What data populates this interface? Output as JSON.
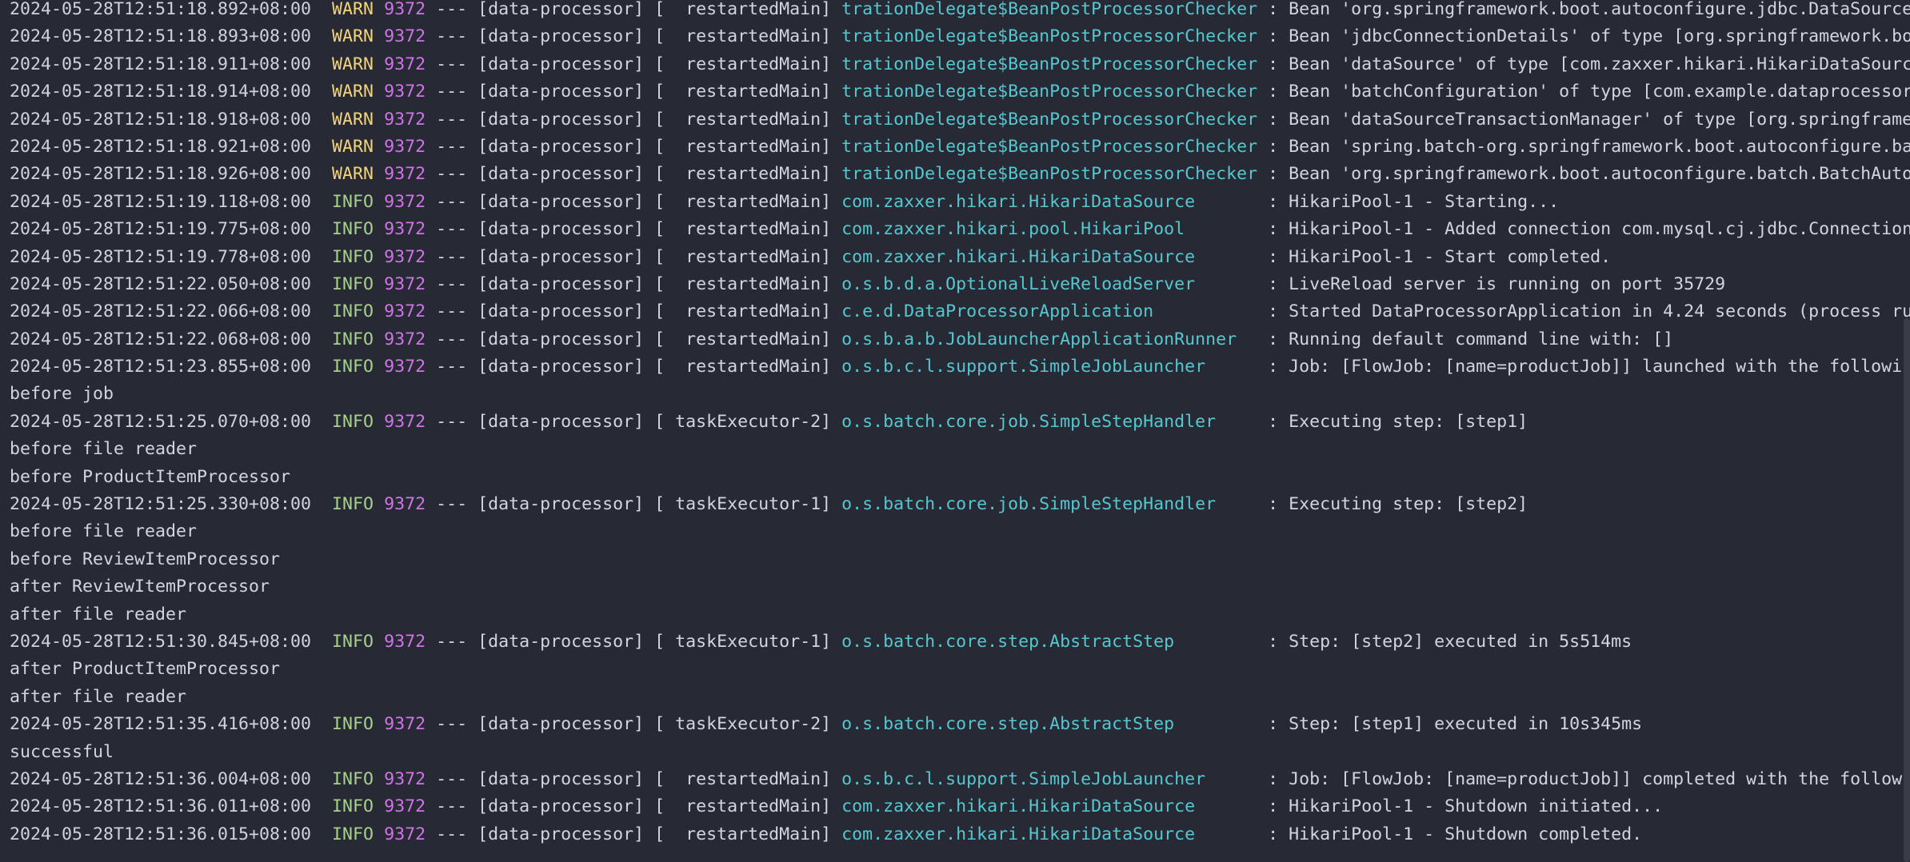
{
  "colors": {
    "background": "#272935",
    "timestamp": "#d0d2da",
    "warn": "#f2d37a",
    "info": "#a6d189",
    "pid": "#d174e8",
    "logger": "#55c7cf",
    "text": "#d3d5dd"
  },
  "lines": [
    {
      "type": "log",
      "ts": "2024-05-28T12:51:18.892+08:00",
      "level": "WARN",
      "pid": "9372",
      "app": " --- [data-processor] [  restartedMain] ",
      "logger": "trationDelegate$BeanPostProcessorChecker",
      "msg": " : Bean 'org.springframework.boot.autoconfigure.jdbc.DataSource"
    },
    {
      "type": "log",
      "ts": "2024-05-28T12:51:18.893+08:00",
      "level": "WARN",
      "pid": "9372",
      "app": " --- [data-processor] [  restartedMain] ",
      "logger": "trationDelegate$BeanPostProcessorChecker",
      "msg": " : Bean 'jdbcConnectionDetails' of type [org.springframework.bo"
    },
    {
      "type": "log",
      "ts": "2024-05-28T12:51:18.911+08:00",
      "level": "WARN",
      "pid": "9372",
      "app": " --- [data-processor] [  restartedMain] ",
      "logger": "trationDelegate$BeanPostProcessorChecker",
      "msg": " : Bean 'dataSource' of type [com.zaxxer.hikari.HikariDataSourc"
    },
    {
      "type": "log",
      "ts": "2024-05-28T12:51:18.914+08:00",
      "level": "WARN",
      "pid": "9372",
      "app": " --- [data-processor] [  restartedMain] ",
      "logger": "trationDelegate$BeanPostProcessorChecker",
      "msg": " : Bean 'batchConfiguration' of type [com.example.dataprocessor"
    },
    {
      "type": "log",
      "ts": "2024-05-28T12:51:18.918+08:00",
      "level": "WARN",
      "pid": "9372",
      "app": " --- [data-processor] [  restartedMain] ",
      "logger": "trationDelegate$BeanPostProcessorChecker",
      "msg": " : Bean 'dataSourceTransactionManager' of type [org.springframe"
    },
    {
      "type": "log",
      "ts": "2024-05-28T12:51:18.921+08:00",
      "level": "WARN",
      "pid": "9372",
      "app": " --- [data-processor] [  restartedMain] ",
      "logger": "trationDelegate$BeanPostProcessorChecker",
      "msg": " : Bean 'spring.batch-org.springframework.boot.autoconfigure.ba"
    },
    {
      "type": "log",
      "ts": "2024-05-28T12:51:18.926+08:00",
      "level": "WARN",
      "pid": "9372",
      "app": " --- [data-processor] [  restartedMain] ",
      "logger": "trationDelegate$BeanPostProcessorChecker",
      "msg": " : Bean 'org.springframework.boot.autoconfigure.batch.BatchAuto"
    },
    {
      "type": "log",
      "ts": "2024-05-28T12:51:19.118+08:00",
      "level": "INFO",
      "pid": "9372",
      "app": " --- [data-processor] [  restartedMain] ",
      "logger": "com.zaxxer.hikari.HikariDataSource      ",
      "msg": " : HikariPool-1 - Starting..."
    },
    {
      "type": "log",
      "ts": "2024-05-28T12:51:19.775+08:00",
      "level": "INFO",
      "pid": "9372",
      "app": " --- [data-processor] [  restartedMain] ",
      "logger": "com.zaxxer.hikari.pool.HikariPool       ",
      "msg": " : HikariPool-1 - Added connection com.mysql.cj.jdbc.Connection"
    },
    {
      "type": "log",
      "ts": "2024-05-28T12:51:19.778+08:00",
      "level": "INFO",
      "pid": "9372",
      "app": " --- [data-processor] [  restartedMain] ",
      "logger": "com.zaxxer.hikari.HikariDataSource      ",
      "msg": " : HikariPool-1 - Start completed."
    },
    {
      "type": "log",
      "ts": "2024-05-28T12:51:22.050+08:00",
      "level": "INFO",
      "pid": "9372",
      "app": " --- [data-processor] [  restartedMain] ",
      "logger": "o.s.b.d.a.OptionalLiveReloadServer      ",
      "msg": " : LiveReload server is running on port 35729"
    },
    {
      "type": "log",
      "ts": "2024-05-28T12:51:22.066+08:00",
      "level": "INFO",
      "pid": "9372",
      "app": " --- [data-processor] [  restartedMain] ",
      "logger": "c.e.d.DataProcessorApplication          ",
      "msg": " : Started DataProcessorApplication in 4.24 seconds (process ru"
    },
    {
      "type": "log",
      "ts": "2024-05-28T12:51:22.068+08:00",
      "level": "INFO",
      "pid": "9372",
      "app": " --- [data-processor] [  restartedMain] ",
      "logger": "o.s.b.a.b.JobLauncherApplicationRunner  ",
      "msg": " : Running default command line with: []"
    },
    {
      "type": "log",
      "ts": "2024-05-28T12:51:23.855+08:00",
      "level": "INFO",
      "pid": "9372",
      "app": " --- [data-processor] [  restartedMain] ",
      "logger": "o.s.b.c.l.support.SimpleJobLauncher     ",
      "msg": " : Job: [FlowJob: [name=productJob]] launched with the followin"
    },
    {
      "type": "plain",
      "text": "before job"
    },
    {
      "type": "log",
      "ts": "2024-05-28T12:51:25.070+08:00",
      "level": "INFO",
      "pid": "9372",
      "app": " --- [data-processor] [ taskExecutor-2] ",
      "logger": "o.s.batch.core.job.SimpleStepHandler    ",
      "msg": " : Executing step: [step1]"
    },
    {
      "type": "plain",
      "text": "before file reader"
    },
    {
      "type": "plain",
      "text": "before ProductItemProcessor"
    },
    {
      "type": "log",
      "ts": "2024-05-28T12:51:25.330+08:00",
      "level": "INFO",
      "pid": "9372",
      "app": " --- [data-processor] [ taskExecutor-1] ",
      "logger": "o.s.batch.core.job.SimpleStepHandler    ",
      "msg": " : Executing step: [step2]"
    },
    {
      "type": "plain",
      "text": "before file reader"
    },
    {
      "type": "plain",
      "text": "before ReviewItemProcessor"
    },
    {
      "type": "plain",
      "text": "after ReviewItemProcessor"
    },
    {
      "type": "plain",
      "text": "after file reader"
    },
    {
      "type": "log",
      "ts": "2024-05-28T12:51:30.845+08:00",
      "level": "INFO",
      "pid": "9372",
      "app": " --- [data-processor] [ taskExecutor-1] ",
      "logger": "o.s.batch.core.step.AbstractStep        ",
      "msg": " : Step: [step2] executed in 5s514ms"
    },
    {
      "type": "plain",
      "text": "after ProductItemProcessor"
    },
    {
      "type": "plain",
      "text": "after file reader"
    },
    {
      "type": "log",
      "ts": "2024-05-28T12:51:35.416+08:00",
      "level": "INFO",
      "pid": "9372",
      "app": " --- [data-processor] [ taskExecutor-2] ",
      "logger": "o.s.batch.core.step.AbstractStep        ",
      "msg": " : Step: [step1] executed in 10s345ms"
    },
    {
      "type": "plain",
      "text": "successful"
    },
    {
      "type": "log",
      "ts": "2024-05-28T12:51:36.004+08:00",
      "level": "INFO",
      "pid": "9372",
      "app": " --- [data-processor] [  restartedMain] ",
      "logger": "o.s.b.c.l.support.SimpleJobLauncher     ",
      "msg": " : Job: [FlowJob: [name=productJob]] completed with the followi"
    },
    {
      "type": "log",
      "ts": "2024-05-28T12:51:36.011+08:00",
      "level": "INFO",
      "pid": "9372",
      "app": " --- [data-processor] [  restartedMain] ",
      "logger": "com.zaxxer.hikari.HikariDataSource      ",
      "msg": " : HikariPool-1 - Shutdown initiated..."
    },
    {
      "type": "log",
      "ts": "2024-05-28T12:51:36.015+08:00",
      "level": "INFO",
      "pid": "9372",
      "app": " --- [data-processor] [  restartedMain] ",
      "logger": "com.zaxxer.hikari.HikariDataSource      ",
      "msg": " : HikariPool-1 - Shutdown completed."
    }
  ]
}
